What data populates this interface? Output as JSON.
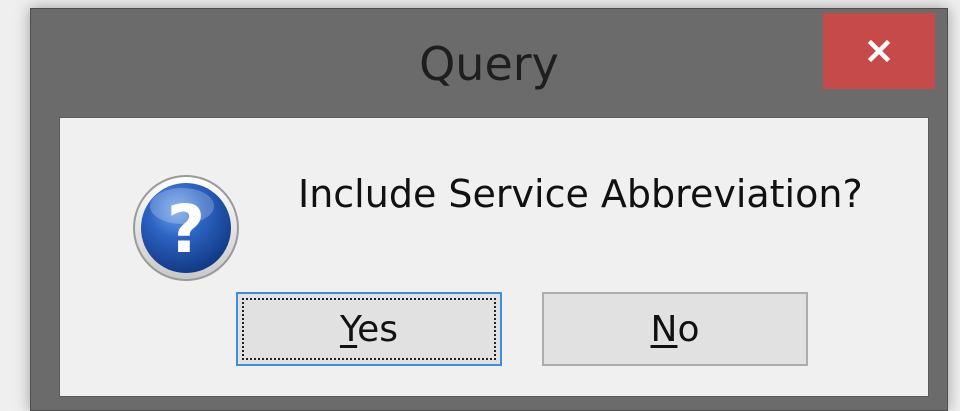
{
  "dialog": {
    "title": "Query",
    "close_icon": "close-x-icon",
    "message": "Include Service Abbreviation?",
    "icon": "question-icon",
    "buttons": {
      "yes": {
        "mnemonic": "Y",
        "rest": "es",
        "label": "Yes"
      },
      "no": {
        "mnemonic": "N",
        "rest": "o",
        "label": "No"
      }
    }
  },
  "colors": {
    "frame": "#6b6b6b",
    "close_button": "#c74a4a",
    "client_background": "#f0f0f0",
    "focus_border": "#3c8fde",
    "icon_blue": "#1f4fa3"
  }
}
